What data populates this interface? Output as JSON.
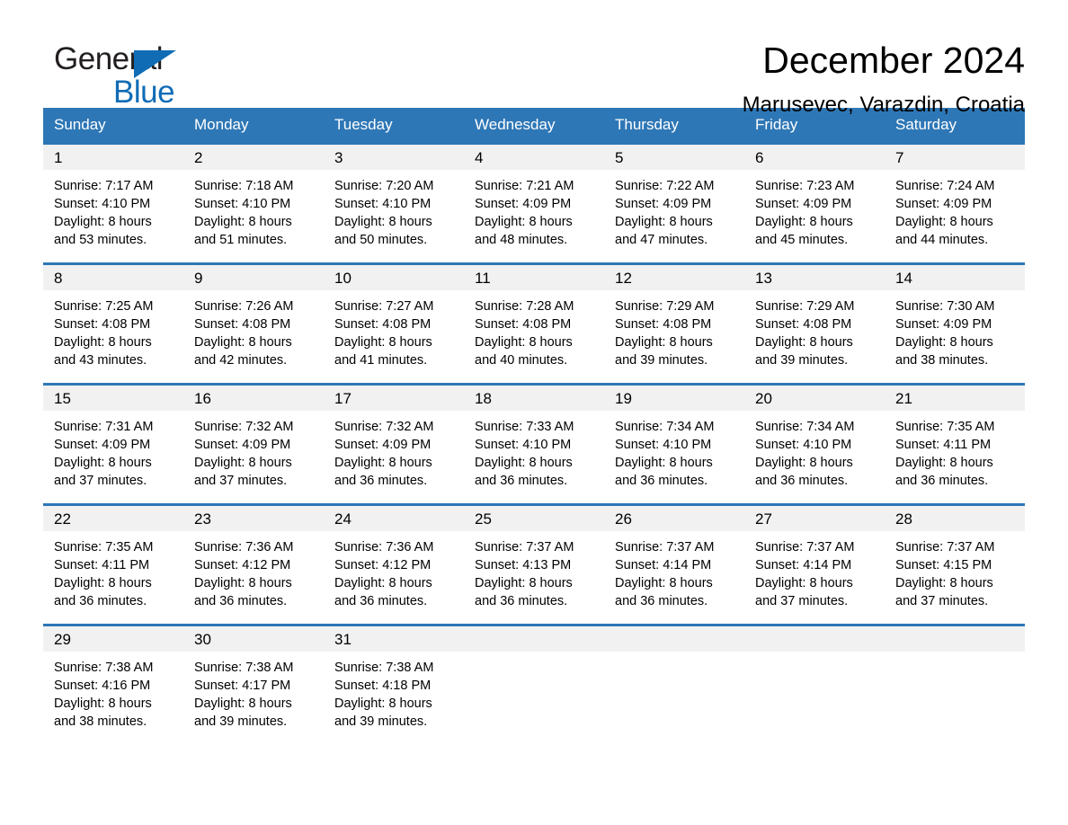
{
  "brand": {
    "name_part1": "General",
    "name_part2": "Blue",
    "accent_color": "#106cb5"
  },
  "header": {
    "title": "December 2024",
    "subtitle": "Marusevec, Varazdin, Croatia"
  },
  "theme": {
    "header_bar_color": "#2e77b6",
    "day_band_color": "#f1f1f1",
    "page_background": "#ffffff"
  },
  "weekday_headers": [
    "Sunday",
    "Monday",
    "Tuesday",
    "Wednesday",
    "Thursday",
    "Friday",
    "Saturday"
  ],
  "weeks": [
    [
      {
        "day": "1",
        "sunrise": "Sunrise: 7:17 AM",
        "sunset": "Sunset: 4:10 PM",
        "daylight_line1": "Daylight: 8 hours",
        "daylight_line2": "and 53 minutes."
      },
      {
        "day": "2",
        "sunrise": "Sunrise: 7:18 AM",
        "sunset": "Sunset: 4:10 PM",
        "daylight_line1": "Daylight: 8 hours",
        "daylight_line2": "and 51 minutes."
      },
      {
        "day": "3",
        "sunrise": "Sunrise: 7:20 AM",
        "sunset": "Sunset: 4:10 PM",
        "daylight_line1": "Daylight: 8 hours",
        "daylight_line2": "and 50 minutes."
      },
      {
        "day": "4",
        "sunrise": "Sunrise: 7:21 AM",
        "sunset": "Sunset: 4:09 PM",
        "daylight_line1": "Daylight: 8 hours",
        "daylight_line2": "and 48 minutes."
      },
      {
        "day": "5",
        "sunrise": "Sunrise: 7:22 AM",
        "sunset": "Sunset: 4:09 PM",
        "daylight_line1": "Daylight: 8 hours",
        "daylight_line2": "and 47 minutes."
      },
      {
        "day": "6",
        "sunrise": "Sunrise: 7:23 AM",
        "sunset": "Sunset: 4:09 PM",
        "daylight_line1": "Daylight: 8 hours",
        "daylight_line2": "and 45 minutes."
      },
      {
        "day": "7",
        "sunrise": "Sunrise: 7:24 AM",
        "sunset": "Sunset: 4:09 PM",
        "daylight_line1": "Daylight: 8 hours",
        "daylight_line2": "and 44 minutes."
      }
    ],
    [
      {
        "day": "8",
        "sunrise": "Sunrise: 7:25 AM",
        "sunset": "Sunset: 4:08 PM",
        "daylight_line1": "Daylight: 8 hours",
        "daylight_line2": "and 43 minutes."
      },
      {
        "day": "9",
        "sunrise": "Sunrise: 7:26 AM",
        "sunset": "Sunset: 4:08 PM",
        "daylight_line1": "Daylight: 8 hours",
        "daylight_line2": "and 42 minutes."
      },
      {
        "day": "10",
        "sunrise": "Sunrise: 7:27 AM",
        "sunset": "Sunset: 4:08 PM",
        "daylight_line1": "Daylight: 8 hours",
        "daylight_line2": "and 41 minutes."
      },
      {
        "day": "11",
        "sunrise": "Sunrise: 7:28 AM",
        "sunset": "Sunset: 4:08 PM",
        "daylight_line1": "Daylight: 8 hours",
        "daylight_line2": "and 40 minutes."
      },
      {
        "day": "12",
        "sunrise": "Sunrise: 7:29 AM",
        "sunset": "Sunset: 4:08 PM",
        "daylight_line1": "Daylight: 8 hours",
        "daylight_line2": "and 39 minutes."
      },
      {
        "day": "13",
        "sunrise": "Sunrise: 7:29 AM",
        "sunset": "Sunset: 4:08 PM",
        "daylight_line1": "Daylight: 8 hours",
        "daylight_line2": "and 39 minutes."
      },
      {
        "day": "14",
        "sunrise": "Sunrise: 7:30 AM",
        "sunset": "Sunset: 4:09 PM",
        "daylight_line1": "Daylight: 8 hours",
        "daylight_line2": "and 38 minutes."
      }
    ],
    [
      {
        "day": "15",
        "sunrise": "Sunrise: 7:31 AM",
        "sunset": "Sunset: 4:09 PM",
        "daylight_line1": "Daylight: 8 hours",
        "daylight_line2": "and 37 minutes."
      },
      {
        "day": "16",
        "sunrise": "Sunrise: 7:32 AM",
        "sunset": "Sunset: 4:09 PM",
        "daylight_line1": "Daylight: 8 hours",
        "daylight_line2": "and 37 minutes."
      },
      {
        "day": "17",
        "sunrise": "Sunrise: 7:32 AM",
        "sunset": "Sunset: 4:09 PM",
        "daylight_line1": "Daylight: 8 hours",
        "daylight_line2": "and 36 minutes."
      },
      {
        "day": "18",
        "sunrise": "Sunrise: 7:33 AM",
        "sunset": "Sunset: 4:10 PM",
        "daylight_line1": "Daylight: 8 hours",
        "daylight_line2": "and 36 minutes."
      },
      {
        "day": "19",
        "sunrise": "Sunrise: 7:34 AM",
        "sunset": "Sunset: 4:10 PM",
        "daylight_line1": "Daylight: 8 hours",
        "daylight_line2": "and 36 minutes."
      },
      {
        "day": "20",
        "sunrise": "Sunrise: 7:34 AM",
        "sunset": "Sunset: 4:10 PM",
        "daylight_line1": "Daylight: 8 hours",
        "daylight_line2": "and 36 minutes."
      },
      {
        "day": "21",
        "sunrise": "Sunrise: 7:35 AM",
        "sunset": "Sunset: 4:11 PM",
        "daylight_line1": "Daylight: 8 hours",
        "daylight_line2": "and 36 minutes."
      }
    ],
    [
      {
        "day": "22",
        "sunrise": "Sunrise: 7:35 AM",
        "sunset": "Sunset: 4:11 PM",
        "daylight_line1": "Daylight: 8 hours",
        "daylight_line2": "and 36 minutes."
      },
      {
        "day": "23",
        "sunrise": "Sunrise: 7:36 AM",
        "sunset": "Sunset: 4:12 PM",
        "daylight_line1": "Daylight: 8 hours",
        "daylight_line2": "and 36 minutes."
      },
      {
        "day": "24",
        "sunrise": "Sunrise: 7:36 AM",
        "sunset": "Sunset: 4:12 PM",
        "daylight_line1": "Daylight: 8 hours",
        "daylight_line2": "and 36 minutes."
      },
      {
        "day": "25",
        "sunrise": "Sunrise: 7:37 AM",
        "sunset": "Sunset: 4:13 PM",
        "daylight_line1": "Daylight: 8 hours",
        "daylight_line2": "and 36 minutes."
      },
      {
        "day": "26",
        "sunrise": "Sunrise: 7:37 AM",
        "sunset": "Sunset: 4:14 PM",
        "daylight_line1": "Daylight: 8 hours",
        "daylight_line2": "and 36 minutes."
      },
      {
        "day": "27",
        "sunrise": "Sunrise: 7:37 AM",
        "sunset": "Sunset: 4:14 PM",
        "daylight_line1": "Daylight: 8 hours",
        "daylight_line2": "and 37 minutes."
      },
      {
        "day": "28",
        "sunrise": "Sunrise: 7:37 AM",
        "sunset": "Sunset: 4:15 PM",
        "daylight_line1": "Daylight: 8 hours",
        "daylight_line2": "and 37 minutes."
      }
    ],
    [
      {
        "day": "29",
        "sunrise": "Sunrise: 7:38 AM",
        "sunset": "Sunset: 4:16 PM",
        "daylight_line1": "Daylight: 8 hours",
        "daylight_line2": "and 38 minutes."
      },
      {
        "day": "30",
        "sunrise": "Sunrise: 7:38 AM",
        "sunset": "Sunset: 4:17 PM",
        "daylight_line1": "Daylight: 8 hours",
        "daylight_line2": "and 39 minutes."
      },
      {
        "day": "31",
        "sunrise": "Sunrise: 7:38 AM",
        "sunset": "Sunset: 4:18 PM",
        "daylight_line1": "Daylight: 8 hours",
        "daylight_line2": "and 39 minutes."
      },
      {
        "day": "",
        "sunrise": "",
        "sunset": "",
        "daylight_line1": "",
        "daylight_line2": ""
      },
      {
        "day": "",
        "sunrise": "",
        "sunset": "",
        "daylight_line1": "",
        "daylight_line2": ""
      },
      {
        "day": "",
        "sunrise": "",
        "sunset": "",
        "daylight_line1": "",
        "daylight_line2": ""
      },
      {
        "day": "",
        "sunrise": "",
        "sunset": "",
        "daylight_line1": "",
        "daylight_line2": ""
      }
    ]
  ]
}
